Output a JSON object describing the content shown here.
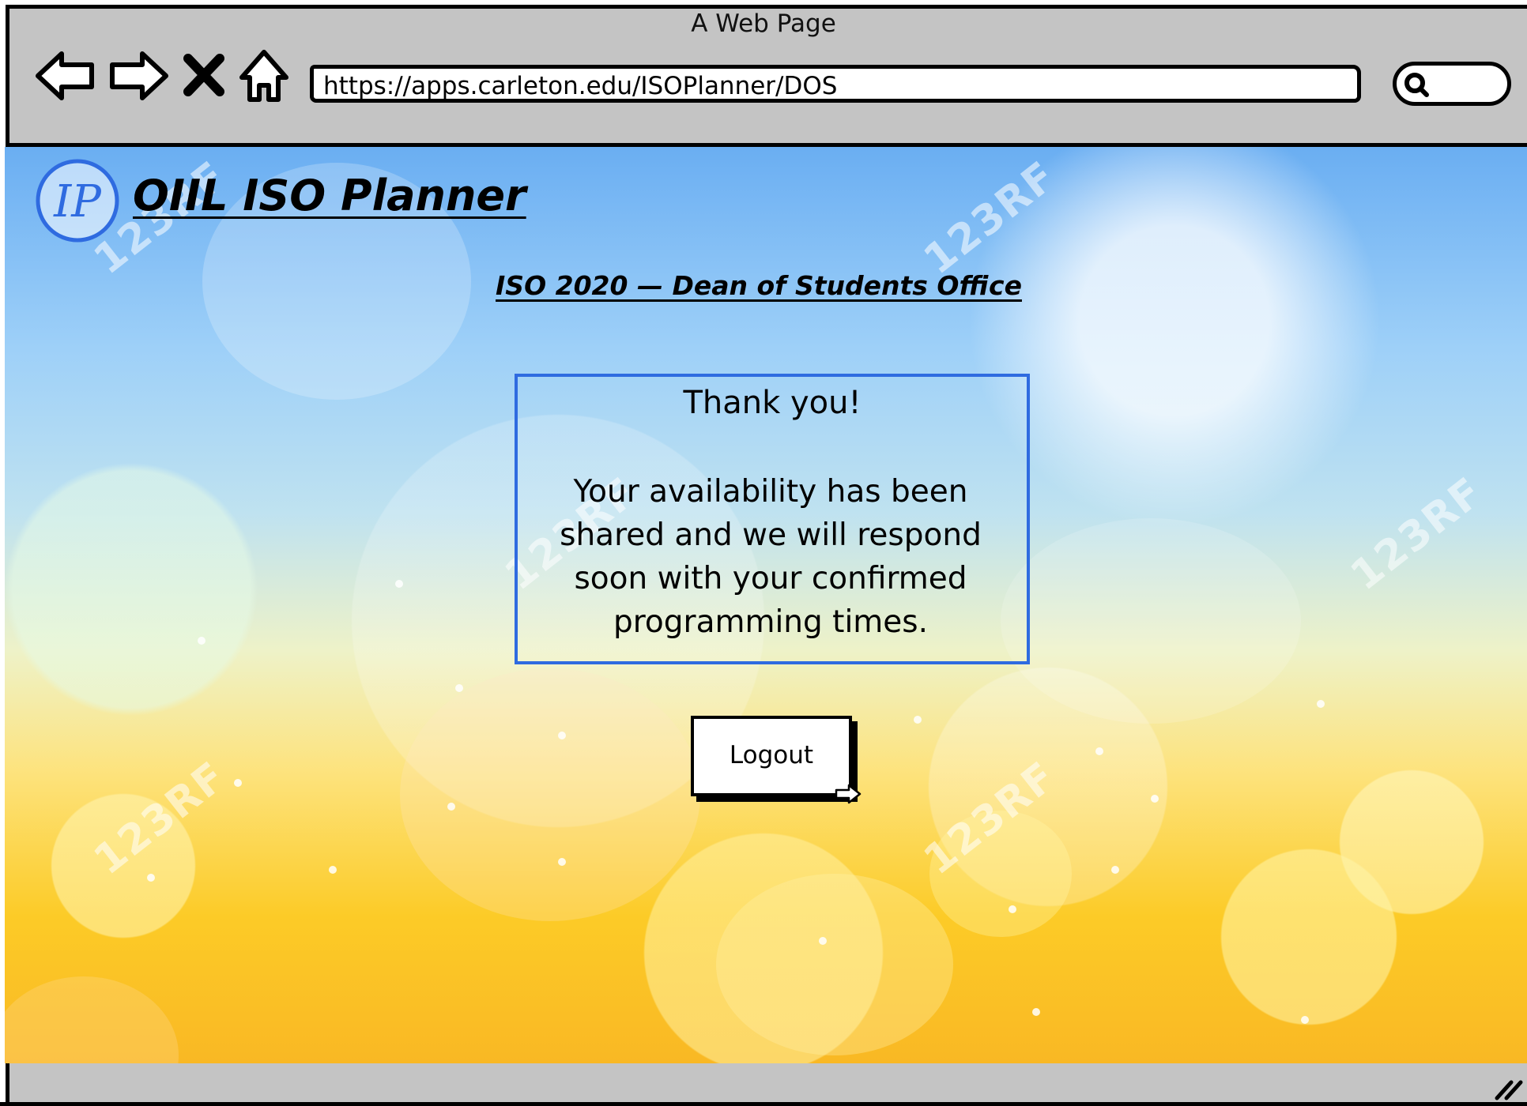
{
  "browser": {
    "window_title": "A Web Page",
    "url": "https://apps.carleton.edu/ISOPlanner/DOS",
    "nav": [
      "back-arrow-icon",
      "forward-arrow-icon",
      "stop-x-icon",
      "home-icon"
    ],
    "search_icon": "search-icon"
  },
  "header": {
    "logo_text": "IP",
    "app_title": "OIIL ISO Planner",
    "subtitle": "ISO 2020 — Dean of Students Office"
  },
  "message": {
    "heading": "Thank you!",
    "body": "Your availability has been shared and we will respond soon with your confirmed programming times."
  },
  "actions": {
    "logout_label": "Logout"
  },
  "colors": {
    "accent": "#2f6be0",
    "chrome": "#c4c4c4"
  }
}
